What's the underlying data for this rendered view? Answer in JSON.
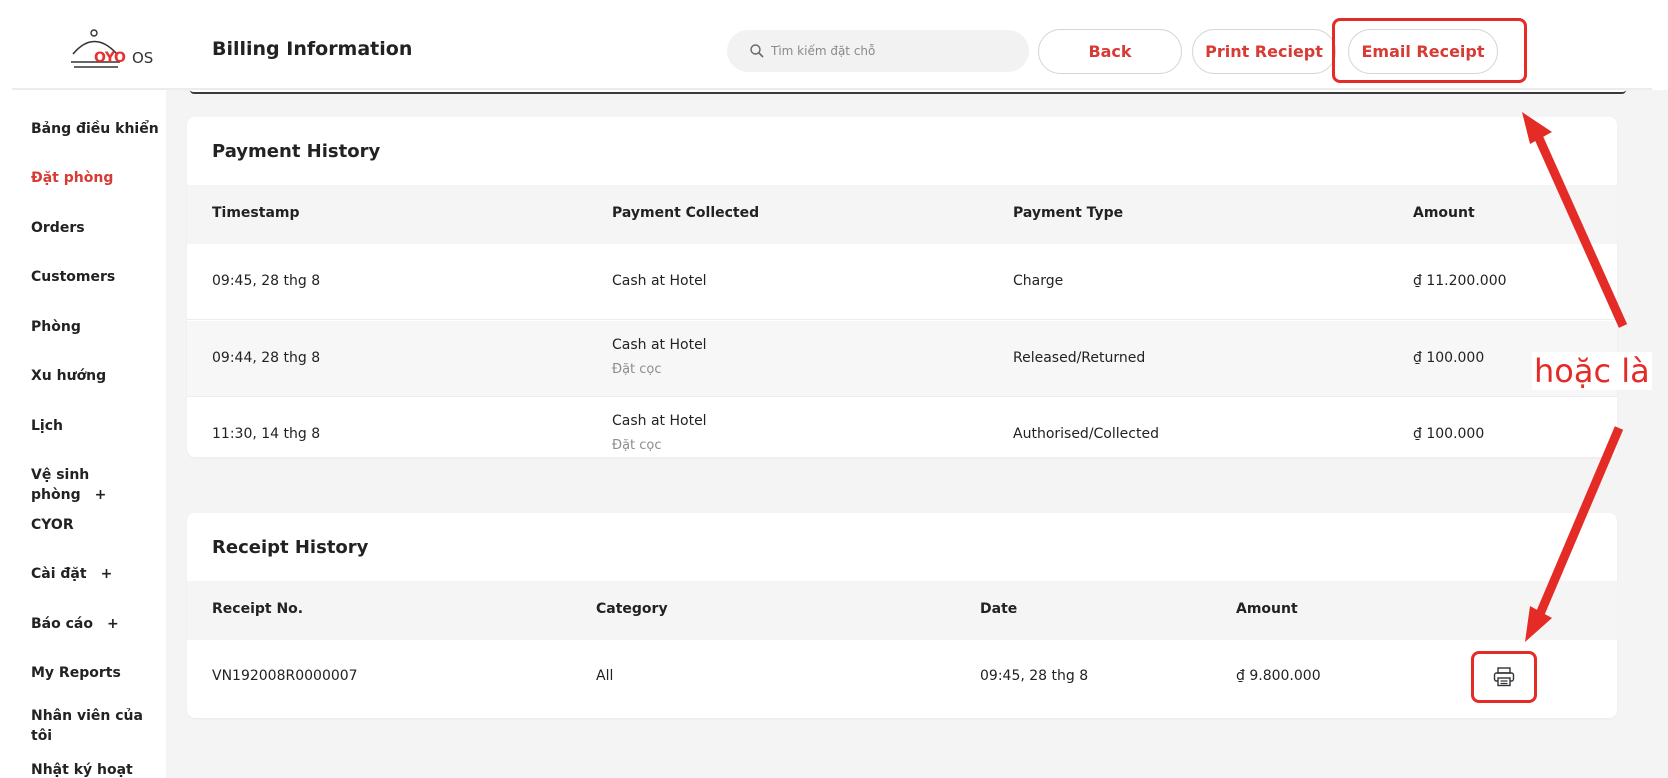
{
  "header": {
    "logo_text": "OYO",
    "logo_suffix": "OS",
    "title": "Billing Information",
    "search_placeholder": "Tìm kiếm đặt chỗ",
    "back_label": "Back",
    "print_label": "Print Reciept",
    "email_label": "Email Receipt"
  },
  "sidebar": {
    "items": [
      {
        "label": "Bảng điều khiển"
      },
      {
        "label": "Đặt phòng"
      },
      {
        "label": "Orders"
      },
      {
        "label": "Customers"
      },
      {
        "label": "Phòng"
      },
      {
        "label": "Xu hướng"
      },
      {
        "label": "Lịch"
      },
      {
        "label": "Vệ sinh phòng",
        "suffix": "+"
      },
      {
        "label": "CYOR"
      },
      {
        "label": "Cài đặt",
        "suffix": "+"
      },
      {
        "label": "Báo cáo",
        "suffix": "+"
      },
      {
        "label": "My Reports"
      },
      {
        "label": "Nhân viên của tôi"
      },
      {
        "label": "Nhật ký hoạt"
      }
    ],
    "active_index": 1
  },
  "payment_history": {
    "title": "Payment History",
    "columns": [
      "Timestamp",
      "Payment Collected",
      "Payment Type",
      "Amount"
    ],
    "rows": [
      {
        "timestamp": "09:45, 28 thg 8",
        "collected": "Cash at Hotel",
        "collected_sub": "",
        "type": "Charge",
        "amount": "₫ 11.200.000"
      },
      {
        "timestamp": "09:44, 28 thg 8",
        "collected": "Cash at Hotel",
        "collected_sub": "Đặt cọc",
        "type": "Released/Returned",
        "amount": "₫ 100.000"
      },
      {
        "timestamp": "11:30, 14 thg 8",
        "collected": "Cash at Hotel",
        "collected_sub": "Đặt cọc",
        "type": "Authorised/Collected",
        "amount": "₫ 100.000"
      }
    ]
  },
  "receipt_history": {
    "title": "Receipt History",
    "columns": [
      "Receipt No.",
      "Category",
      "Date",
      "Amount"
    ],
    "rows": [
      {
        "receipt_no": "VN192008R0000007",
        "category": "All",
        "date": "09:45, 28 thg 8",
        "amount": "₫ 9.800.000",
        "action_icon": "printer-icon"
      }
    ]
  },
  "annotation": {
    "label": "hoặc là",
    "color": "#e52b26"
  },
  "colors": {
    "brand": "#d83a34",
    "highlight": "#e52b26"
  }
}
